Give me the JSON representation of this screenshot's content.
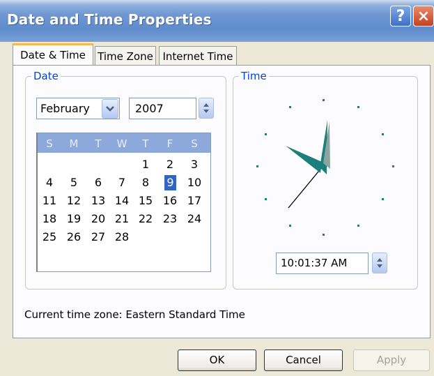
{
  "window": {
    "title": "Date and Time Properties",
    "help_label": "?",
    "close_label": "×"
  },
  "tabs": [
    {
      "label": "Date & Time",
      "active": true
    },
    {
      "label": "Time Zone",
      "active": false
    },
    {
      "label": "Internet Time",
      "active": false
    }
  ],
  "date_group": {
    "label": "Date",
    "month": "February",
    "year": "2007",
    "weekday_headers": [
      "S",
      "M",
      "T",
      "W",
      "T",
      "F",
      "S"
    ],
    "selected_day": "9",
    "weeks": [
      [
        "",
        "",
        "",
        "",
        "1",
        "2",
        "3"
      ],
      [
        "4",
        "5",
        "6",
        "7",
        "8",
        "9",
        "10"
      ],
      [
        "11",
        "12",
        "13",
        "14",
        "15",
        "16",
        "17"
      ],
      [
        "18",
        "19",
        "20",
        "21",
        "22",
        "23",
        "24"
      ],
      [
        "25",
        "26",
        "27",
        "28",
        "",
        "",
        ""
      ]
    ]
  },
  "time_group": {
    "label": "Time",
    "time_value": "10:01:37 AM"
  },
  "timezone_text": "Current time zone:  Eastern Standard Time",
  "buttons": {
    "ok": "OK",
    "cancel": "Cancel",
    "apply": "Apply"
  },
  "colors": {
    "title_bar": "#6f97d2",
    "selected_day": "#3165c4",
    "clock_hands": "#1d7f7a",
    "group_label": "#0046d5"
  }
}
